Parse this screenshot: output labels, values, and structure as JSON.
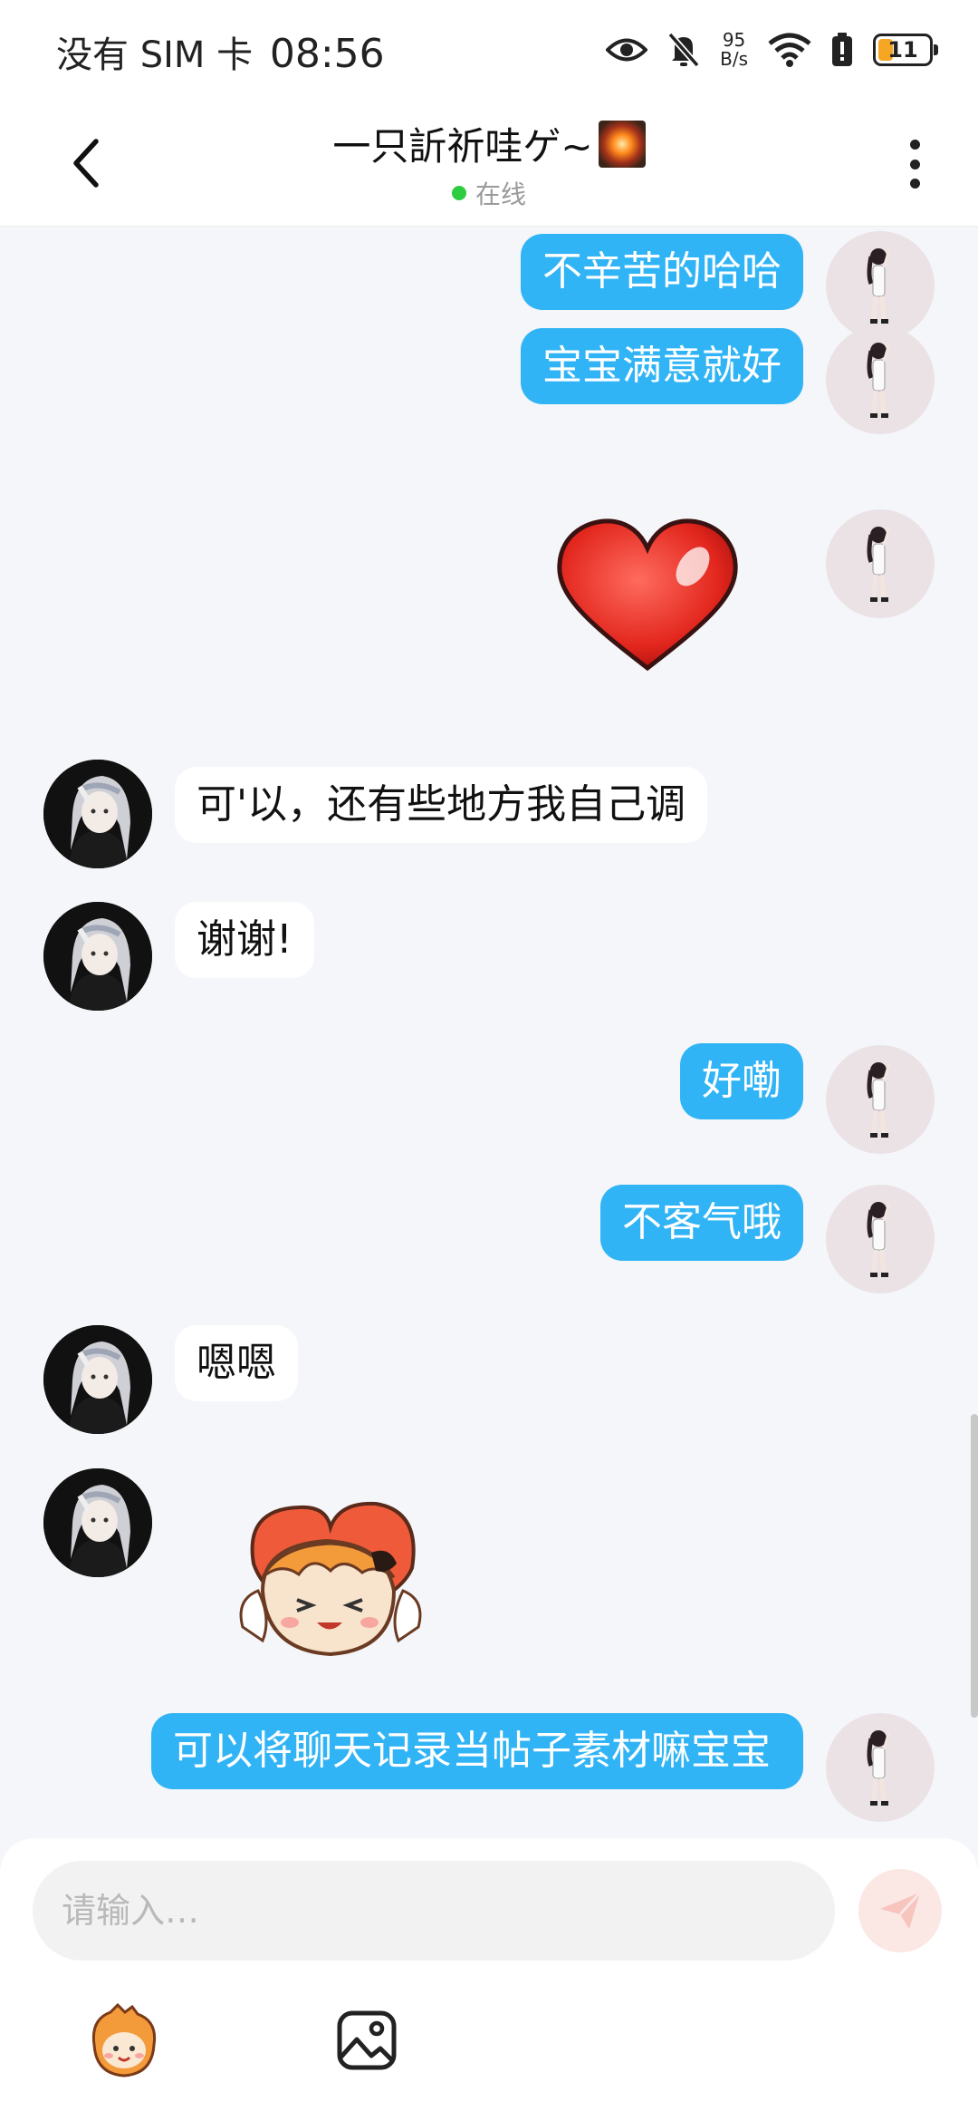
{
  "status_bar": {
    "carrier": "没有 SIM 卡",
    "time": "08:56",
    "net_speed_value": "95",
    "net_speed_unit": "B/s",
    "battery": "11",
    "icons": [
      "eye-icon",
      "bell-muted-icon",
      "wifi-icon",
      "battery-alert-icon",
      "battery-icon"
    ]
  },
  "header": {
    "title": "一只訢祈哇ゲ~",
    "status": "在线",
    "status_color": "#2ecc40"
  },
  "messages": [
    {
      "side": "out",
      "type": "text",
      "text": "不辛苦的哈哈"
    },
    {
      "side": "out",
      "type": "text",
      "text": "宝宝满意就好"
    },
    {
      "side": "out",
      "type": "sticker",
      "sticker": "red-heart"
    },
    {
      "side": "in",
      "type": "text",
      "text": "可'以，还有些地方我自己调"
    },
    {
      "side": "in",
      "type": "text",
      "text": "谢谢!"
    },
    {
      "side": "out",
      "type": "text",
      "text": "好嘞"
    },
    {
      "side": "out",
      "type": "text",
      "text": "不客气哦"
    },
    {
      "side": "in",
      "type": "text",
      "text": "嗯嗯"
    },
    {
      "side": "in",
      "type": "sticker",
      "sticker": "cartoon-girl-with-heart"
    },
    {
      "side": "out",
      "type": "text",
      "text": "可以将聊天记录当帖子素材嘛宝宝"
    }
  ],
  "input": {
    "placeholder": "请输入…",
    "value": ""
  },
  "toolbar": {
    "emoji_icon": "emoji-sticker-icon",
    "image_icon": "image-icon"
  },
  "colors": {
    "outgoing_bubble": "#31b4f5",
    "incoming_bubble": "#ffffff",
    "background": "#f4f6f9"
  }
}
